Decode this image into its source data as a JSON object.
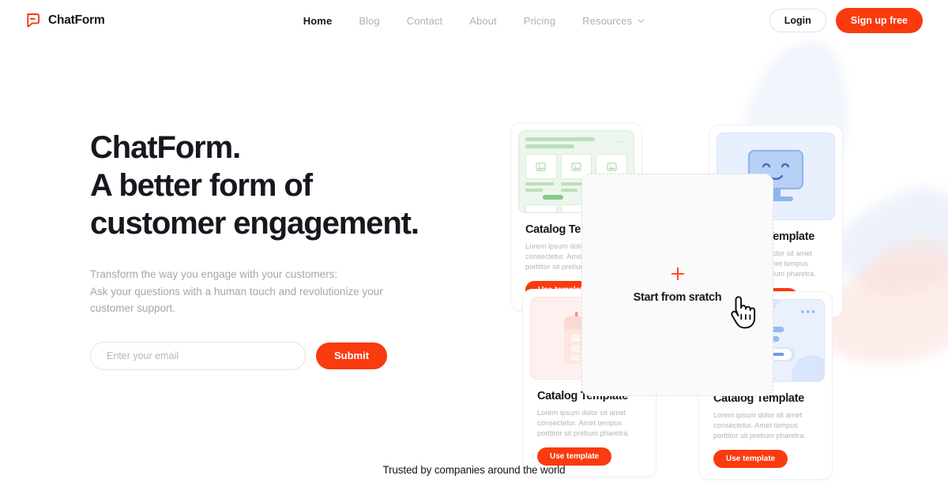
{
  "brand": {
    "name": "ChatForm",
    "logo_icon": "chat-bubble-icon",
    "accent": "#fa3a0f"
  },
  "nav": {
    "items": [
      {
        "label": "Home",
        "active": true
      },
      {
        "label": "Blog",
        "active": false
      },
      {
        "label": "Contact",
        "active": false
      },
      {
        "label": "About",
        "active": false
      },
      {
        "label": "Pricing",
        "active": false
      },
      {
        "label": "Resources",
        "active": false,
        "has_dropdown": true,
        "icon": "chevron-down-icon"
      }
    ]
  },
  "auth": {
    "login_label": "Login",
    "signup_label": "Sign up free"
  },
  "hero": {
    "headline_line1": "ChatForm.",
    "headline_line2": "A better form of",
    "headline_line3": "customer engagement.",
    "sub_line1": "Transform the way you engage with your customers:",
    "sub_line2": "Ask your questions with a human touch and revolutionize your",
    "sub_line3": "customer support.",
    "email_placeholder": "Enter your email",
    "email_value": "",
    "submit_label": "Submit"
  },
  "templates": {
    "description": "Lorem ipsum dolor sit amet consectetur. Amet tempus porttitor sit pretium pharetra.",
    "use_label": "Use template",
    "cards": [
      {
        "title": "Catalog Template",
        "thumb": "catalog-grid-thumbnail",
        "tint": "#ecf6ec"
      },
      {
        "title": "Catalog Template",
        "thumb": "smiley-monitor-thumbnail",
        "tint": "#e9f0fd"
      },
      {
        "title": "Catalog Template",
        "thumb": "calendar-thumbnail",
        "tint": "#fdf0ee"
      },
      {
        "title": "Catalog Template",
        "thumb": "chat-form-thumbnail",
        "tint": "#eaf1fd"
      }
    ]
  },
  "scratch": {
    "label": "Start from sratch",
    "plus_icon": "plus-icon",
    "cursor_icon": "hand-pointer-icon"
  },
  "trusted": {
    "text": "Trusted by companies around the world"
  }
}
